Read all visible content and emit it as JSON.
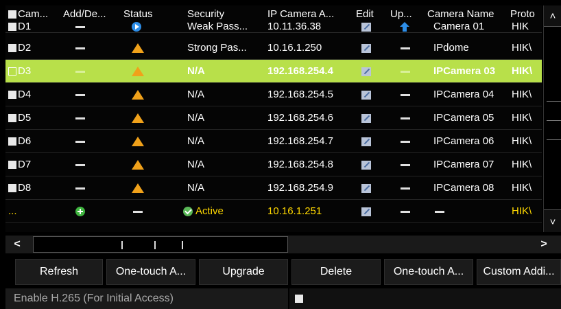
{
  "columns": {
    "cam": "Cam...",
    "add": "Add/De...",
    "status": "Status",
    "security": "Security",
    "ip": "IP Camera A...",
    "edit": "Edit",
    "upgrade": "Up...",
    "name": "Camera Name",
    "protocol": "Proto"
  },
  "first_row": {
    "security": "Weak Pass...",
    "ip": "10.11.36.38",
    "name": "Camera 01",
    "protocol": "HIK"
  },
  "rows": [
    {
      "id": "D2",
      "security": "Strong Pas...",
      "ip": "10.16.1.250",
      "name": "IPdome",
      "protocol": "HIK\\"
    },
    {
      "id": "D3",
      "security": "N/A",
      "ip": "192.168.254.4",
      "name": "IPCamera 03",
      "protocol": "HIK\\"
    },
    {
      "id": "D4",
      "security": "N/A",
      "ip": "192.168.254.5",
      "name": "IPCamera 04",
      "protocol": "HIK\\"
    },
    {
      "id": "D5",
      "security": "N/A",
      "ip": "192.168.254.6",
      "name": "IPCamera 05",
      "protocol": "HIK\\"
    },
    {
      "id": "D6",
      "security": "N/A",
      "ip": "192.168.254.7",
      "name": "IPCamera 06",
      "protocol": "HIK\\"
    },
    {
      "id": "D7",
      "security": "N/A",
      "ip": "192.168.254.8",
      "name": "IPCamera 07",
      "protocol": "HIK\\"
    },
    {
      "id": "D8",
      "security": "N/A",
      "ip": "192.168.254.9",
      "name": "IPCamera 08",
      "protocol": "HIK\\"
    }
  ],
  "first_id": "D1",
  "last_row": {
    "id": "...",
    "security": "Active",
    "ip": "10.16.1.251",
    "protocol": "HIK\\"
  },
  "buttons": {
    "refresh": "Refresh",
    "one_touch_activate": "One-touch A...",
    "upgrade": "Upgrade",
    "delete": "Delete",
    "one_touch_add": "One-touch A...",
    "custom_add": "Custom Addi..."
  },
  "footer": {
    "h265_label": "Enable H.265 (For Initial Access)"
  },
  "icons": {
    "scroll_up": "˄",
    "scroll_down": "˅",
    "scroll_left": "<",
    "scroll_right": ">"
  },
  "colors": {
    "selected_row": "#b8e04a",
    "active_row_text": "#ffd800",
    "warning": "#f0a11a"
  }
}
